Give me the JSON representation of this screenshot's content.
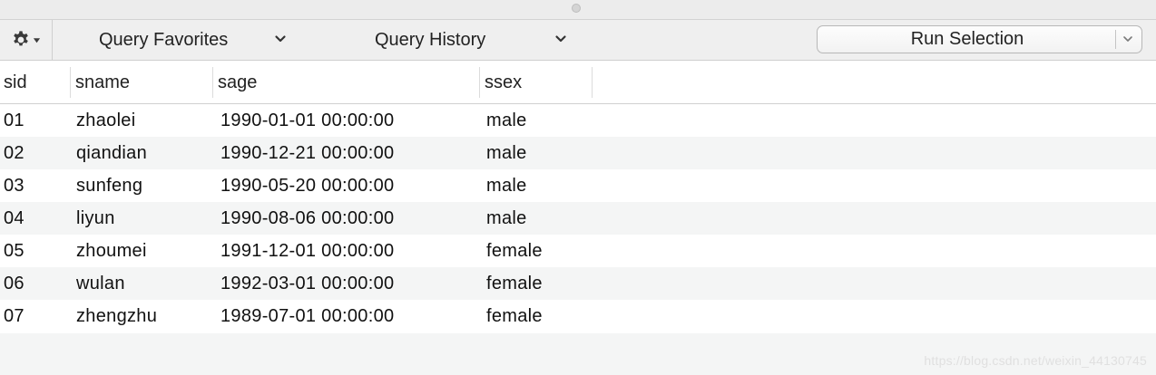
{
  "toolbar": {
    "favorites_label": "Query Favorites",
    "history_label": "Query History",
    "run_label": "Run Selection"
  },
  "table": {
    "columns": [
      "sid",
      "sname",
      "sage",
      "ssex"
    ],
    "rows": [
      [
        "01",
        "zhaolei",
        "1990-01-01 00:00:00",
        "male"
      ],
      [
        "02",
        "qiandian",
        "1990-12-21 00:00:00",
        "male"
      ],
      [
        "03",
        "sunfeng",
        "1990-05-20 00:00:00",
        "male"
      ],
      [
        "04",
        "liyun",
        "1990-08-06 00:00:00",
        "male"
      ],
      [
        "05",
        "zhoumei",
        "1991-12-01 00:00:00",
        "female"
      ],
      [
        "06",
        "wulan",
        "1992-03-01 00:00:00",
        "female"
      ],
      [
        "07",
        "zhengzhu",
        "1989-07-01 00:00:00",
        "female"
      ]
    ]
  },
  "watermark": "https://blog.csdn.net/weixin_44130745",
  "icons": {
    "settings": "gear-icon",
    "menu_arrow": "caret-down-icon",
    "dropdown": "chevron-down-icon"
  },
  "colors": {
    "toolbar_bg": "#efefef",
    "row_alt": "#f4f5f5",
    "border": "#cfcfcf"
  }
}
